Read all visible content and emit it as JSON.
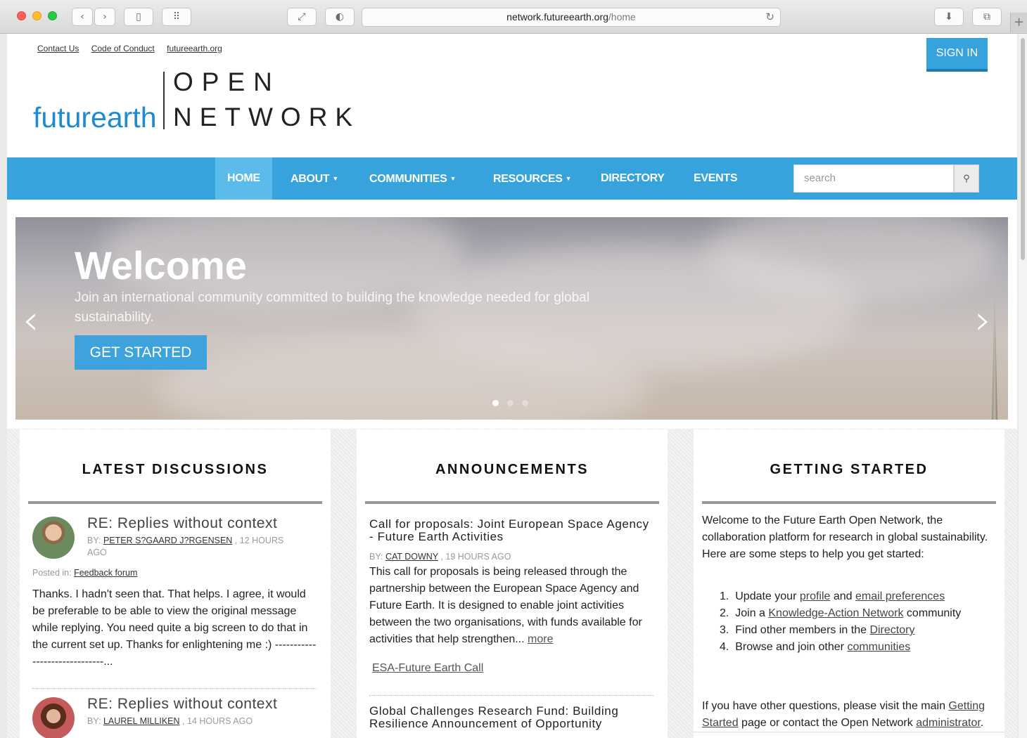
{
  "browser": {
    "url_host": "network.futureearth.org",
    "url_path": "/home"
  },
  "header": {
    "top_links": [
      "Contact Us",
      "Code of Conduct",
      "futureearth.org"
    ],
    "sign_in": "SIGN IN",
    "logo_word": "futurearth",
    "logo_line1": "OPEN",
    "logo_line2": "NETWORK"
  },
  "nav": {
    "items": [
      "HOME",
      "ABOUT",
      "COMMUNITIES",
      "RESOURCES",
      "DIRECTORY",
      "EVENTS"
    ],
    "search_placeholder": "search"
  },
  "hero": {
    "title": "Welcome",
    "subtitle": "Join an international community committed to building the knowledge needed for global sustainability.",
    "button": "GET STARTED"
  },
  "discussions": {
    "heading": "LATEST DISCUSSIONS",
    "items": [
      {
        "title": "RE: Replies without context",
        "by_prefix": "BY: ",
        "author": "PETER S?GAARD J?RGENSEN",
        "time": " , 12 HOURS AGO",
        "posted_prefix": "Posted in: ",
        "forum": "Feedback forum",
        "body": "Thanks. I hadn't seen that. That helps. I agree, it would be preferable to be able to view the original message while replying. You need quite a big screen to do that in the current set up. Thanks for enlightening me :) ------------------------------..."
      },
      {
        "title": "RE: Replies without context",
        "by_prefix": "BY: ",
        "author": "LAUREL MILLIKEN",
        "time": " , 14 HOURS AGO"
      }
    ]
  },
  "announcements": {
    "heading": "ANNOUNCEMENTS",
    "items": [
      {
        "title": "Call for proposals: Joint European Space Agency - Future Earth Activities",
        "by_prefix": "BY: ",
        "author": "CAT DOWNY",
        "time": " , 19 HOURS AGO",
        "body": "This call for proposals is being released through the partnership between the European Space Agency and Future Earth. It is designed to enable joint activities between the two organisations, with funds available for activities that help strengthen... ",
        "more": "more",
        "link": "ESA-Future Earth Call"
      },
      {
        "title": "Global Challenges Research Fund: Building Resilience Announcement of Opportunity"
      }
    ]
  },
  "getting_started": {
    "heading": "GETTING STARTED",
    "intro": "Welcome to the Future Earth Open Network, the collaboration platform for research in global sustainability.  Here are some steps to help you get started:",
    "steps": [
      {
        "num": "1.",
        "pre": "Update your ",
        "link1": "profile",
        "mid": " and ",
        "link2": "email preferences",
        "post": ""
      },
      {
        "num": "2.",
        "pre": "Join a ",
        "link1": "Knowledge-Action Network",
        "mid": " community",
        "link2": "",
        "post": ""
      },
      {
        "num": "3.",
        "pre": "Find other members in the ",
        "link1": "Directory",
        "mid": "",
        "link2": "",
        "post": ""
      },
      {
        "num": "4.",
        "pre": "Browse and join other ",
        "link1": "communities",
        "mid": "",
        "link2": "",
        "post": ""
      }
    ],
    "footer_pre": "If you have other questions, please visit the main ",
    "footer_link1": "Getting Started",
    "footer_mid": " page or contact the Open Network ",
    "footer_link2": "administrator",
    "footer_post": "."
  },
  "colors": {
    "brand_blue": "#36a3dd",
    "nav_active": "#5bbbea"
  }
}
